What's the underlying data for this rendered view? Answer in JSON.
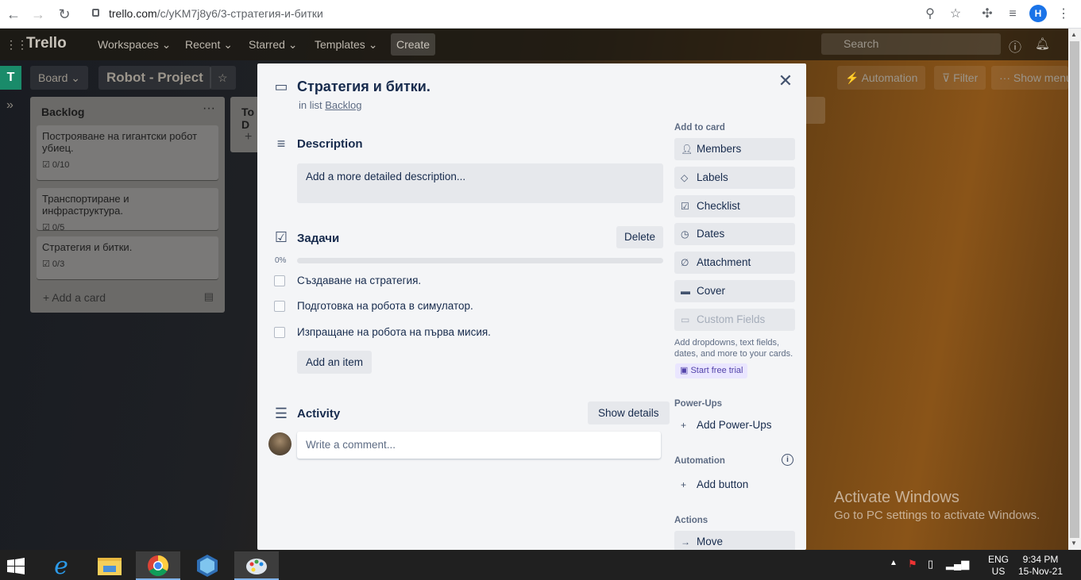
{
  "browser": {
    "url_host": "trello.com",
    "url_path": "/c/yKM7j8y6/3-стратегия-и-битки",
    "profile_initial": "H"
  },
  "topbar": {
    "logo": "Trello",
    "menus": [
      "Workspaces",
      "Recent",
      "Starred",
      "Templates"
    ],
    "create": "Create",
    "search_placeholder": "Search"
  },
  "board": {
    "badge": "T",
    "view": "Board",
    "name": "Robot - Project",
    "automation": "Automation",
    "filter": "Filter",
    "show_menu": "Show menu"
  },
  "lists": [
    {
      "title": "Backlog",
      "cards": [
        {
          "title": "Построяване на гигантски робот убиец.",
          "badge": "0/10"
        },
        {
          "title": "Транспортиране и инфраструктура.",
          "badge": "0/5"
        },
        {
          "title": "Стратегия и битки.",
          "badge": "0/3"
        }
      ],
      "add_card": "Add a card"
    },
    {
      "title": "To D"
    }
  ],
  "modal": {
    "title": "Стратегия и битки.",
    "in_list_prefix": "in list",
    "in_list": "Backlog",
    "description": {
      "heading": "Description",
      "placeholder": "Add a more detailed description..."
    },
    "checklist": {
      "heading": "Задачи",
      "delete": "Delete",
      "progress_label": "0%",
      "progress": 0,
      "items": [
        {
          "text": "Създаване на стратегия.",
          "checked": false
        },
        {
          "text": "Подготовка на робота в симулатор.",
          "checked": false
        },
        {
          "text": "Изпращане на робота на първа мисия.",
          "checked": false
        }
      ],
      "add_item": "Add an item"
    },
    "activity": {
      "heading": "Activity",
      "show_details": "Show details",
      "comment_placeholder": "Write a comment..."
    },
    "sidebar": {
      "add_to_card": "Add to card",
      "buttons": [
        "Members",
        "Labels",
        "Checklist",
        "Dates",
        "Attachment",
        "Cover"
      ],
      "custom_fields": "Custom Fields",
      "promo": "Add dropdowns, text fields, dates, and more to your cards.",
      "trial": "Start free trial",
      "powerups_heading": "Power-Ups",
      "add_powerups": "Add Power-Ups",
      "automation_heading": "Automation",
      "add_button": "Add button",
      "actions_heading": "Actions",
      "move": "Move"
    }
  },
  "watermark": {
    "line1": "Activate Windows",
    "line2": "Go to PC settings to activate Windows."
  },
  "taskbar": {
    "lang1": "ENG",
    "lang2": "US",
    "time": "9:34 PM",
    "date": "15-Nov-21"
  }
}
